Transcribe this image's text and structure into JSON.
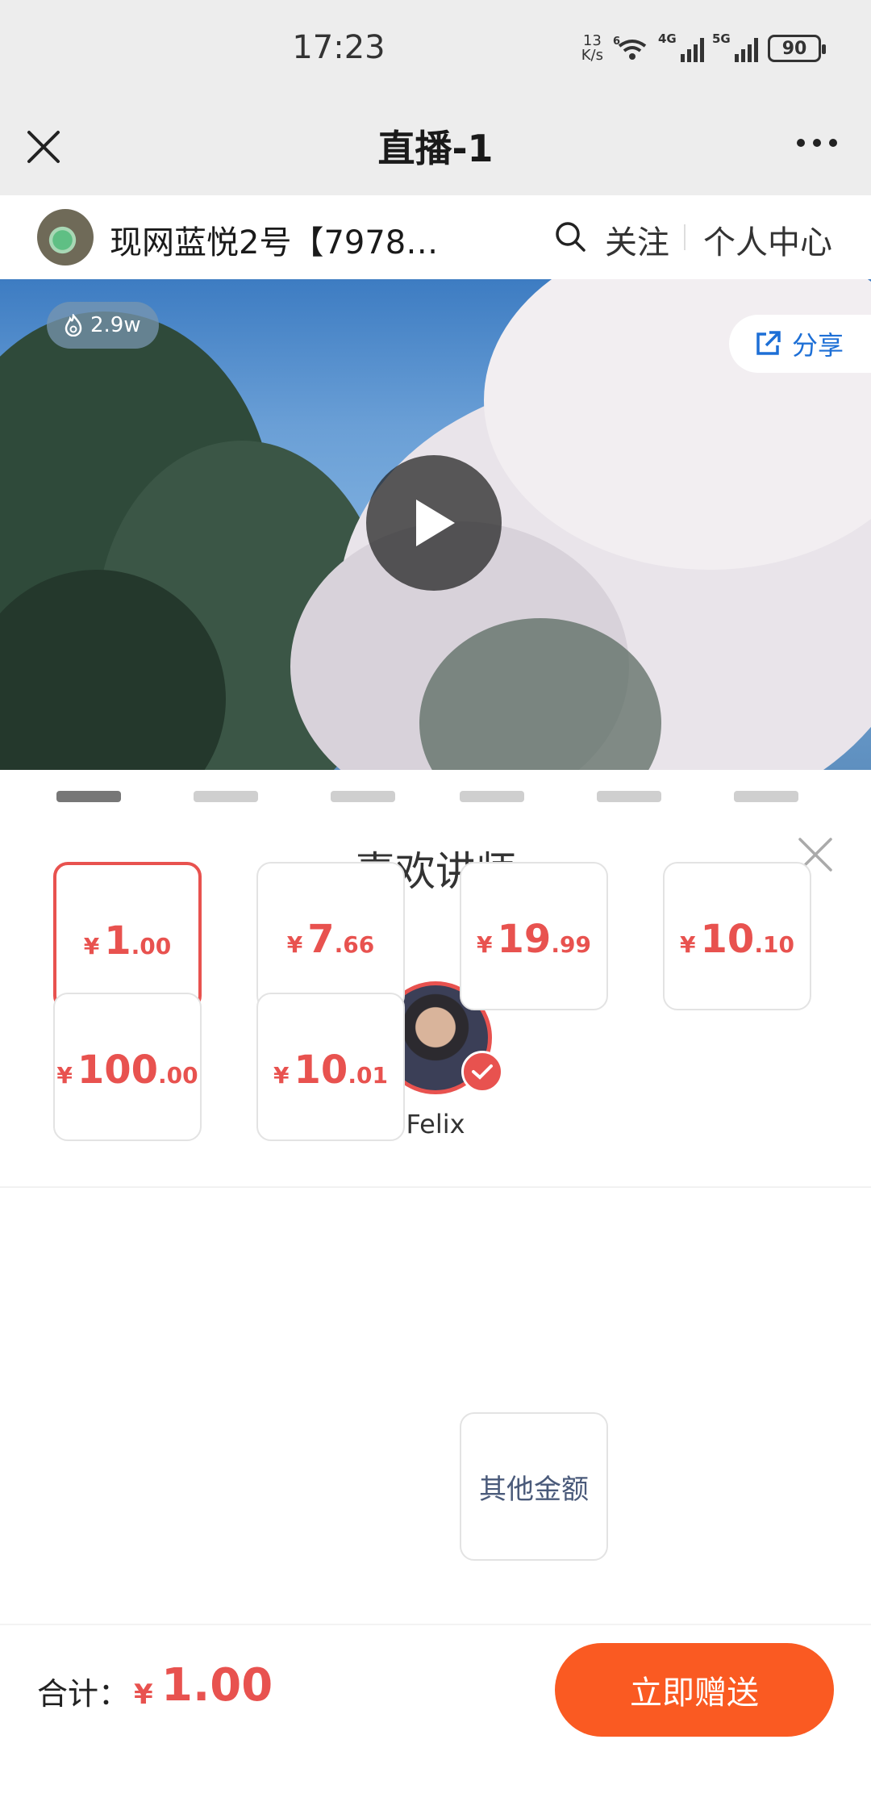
{
  "status_bar": {
    "time": "17:23",
    "net_speed_value": "13",
    "net_speed_unit": "K/s",
    "wifi_label": "6",
    "signal1_label": "4G",
    "signal2_label": "5G",
    "battery": "90"
  },
  "titlebar": {
    "title": "直播-1"
  },
  "channel": {
    "name": "现网蓝悦2号【7978…",
    "follow": "关注",
    "personal_center": "个人中心"
  },
  "video": {
    "views": "2.9w",
    "share": "分享"
  },
  "modal": {
    "title": "喜欢讲师",
    "lecturer_name": "Felix",
    "currency": "¥",
    "amounts": [
      {
        "int": "1",
        "dec": ".00",
        "selected": true
      },
      {
        "int": "7",
        "dec": ".66",
        "selected": false
      },
      {
        "int": "19",
        "dec": ".99",
        "selected": false
      },
      {
        "int": "10",
        "dec": ".10",
        "selected": false
      },
      {
        "int": "100",
        "dec": ".00",
        "selected": false
      },
      {
        "int": "10",
        "dec": ".01",
        "selected": false
      }
    ],
    "other_amount": "其他金额",
    "total_label": "合计：",
    "total_value": "1.00",
    "send_button": "立即赠送"
  },
  "colors": {
    "accent_red": "#e8524f",
    "send_orange": "#fa5a22",
    "share_blue": "#1d6fd6"
  }
}
